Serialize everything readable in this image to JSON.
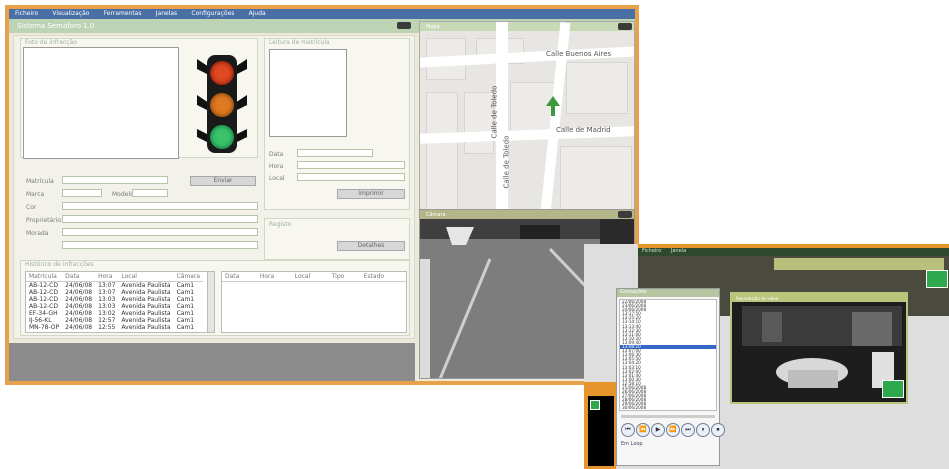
{
  "main": {
    "menu": [
      "Ficheiro",
      "Visualização",
      "Ferramentas",
      "Janelas",
      "Configurações",
      "Ajuda"
    ],
    "title": "Sistema Semáforo 1.0",
    "left": {
      "photo_group_label": "Foto da infracção",
      "plate_group_label": "Leitura de matrícula",
      "fields": [
        "Matrícula",
        "Marca",
        "Modelo",
        "Cor",
        "Proprietário",
        "Morada"
      ],
      "fields_right": [
        "Data",
        "Hora",
        "Local"
      ],
      "buttons": {
        "send": "Enviar",
        "print": "Imprimir",
        "details": "Detalhes"
      },
      "other_group_label": "Registo",
      "history_label": "Histórico de infracções"
    },
    "traffic_light": {
      "red": "#e04a22",
      "amber": "#e07a22",
      "green": "#3ac36a"
    },
    "history": {
      "headers": [
        "Matrícula",
        "Data",
        "Hora",
        "Local",
        "Câmara"
      ],
      "rows": [
        [
          "AB-12-CD",
          "24/06/08",
          "13:07",
          "Avenida Paulista",
          "Cam1"
        ],
        [
          "AB-12-CD",
          "24/06/08",
          "13:07",
          "Avenida Paulista",
          "Cam1"
        ],
        [
          "AB-12-CD",
          "24/06/08",
          "13:03",
          "Avenida Paulista",
          "Cam1"
        ],
        [
          "AB-12-CD",
          "24/06/08",
          "13:03",
          "Avenida Paulista",
          "Cam1"
        ],
        [
          "EF-34-GH",
          "24/06/08",
          "13:02",
          "Avenida Paulista",
          "Cam1"
        ],
        [
          "IJ-56-KL",
          "24/06/08",
          "12:57",
          "Avenida Paulista",
          "Cam1"
        ],
        [
          "MN-78-OP",
          "24/06/08",
          "12:55",
          "Avenida Paulista",
          "Cam1"
        ]
      ],
      "right_headers": [
        "Data",
        "Hora",
        "Local",
        "Tipo",
        "Estado"
      ]
    },
    "map": {
      "title": "Mapa",
      "streets": [
        "Calle Buenos Aires",
        "Calle de Toledo",
        "Calle de Toledo",
        "Calle de Madrid"
      ]
    },
    "camera": {
      "title": "Câmara"
    }
  },
  "second": {
    "menu": [
      "Ficheiro",
      "Janela"
    ],
    "list_title": "Gravações",
    "list_items": [
      "22/06/2008",
      "23/06/2008",
      "24/06/2008",
      "13:17:50",
      "13:15:20",
      "13:14:10",
      "13:13:40",
      "13:12:30",
      "13:11:00",
      "13:10:20",
      "13:09:40",
      "13:08:10",
      "13:07:00",
      "13:06:30",
      "13:05:50",
      "13:04:20",
      "13:03:10",
      "13:02:00",
      "13:01:40",
      "13:00:30",
      "12:58:10",
      "25/06/2008",
      "26/06/2008",
      "27/06/2008",
      "28/06/2008",
      "29/06/2008",
      "30/06/2008"
    ],
    "selected_index": 11,
    "player_title": "Reprodução de vídeo",
    "controls": [
      "⏮",
      "⏪",
      "▶",
      "⏩",
      "⏭",
      "⏸",
      "⏹"
    ],
    "checkbox_label": "Em Loop"
  }
}
